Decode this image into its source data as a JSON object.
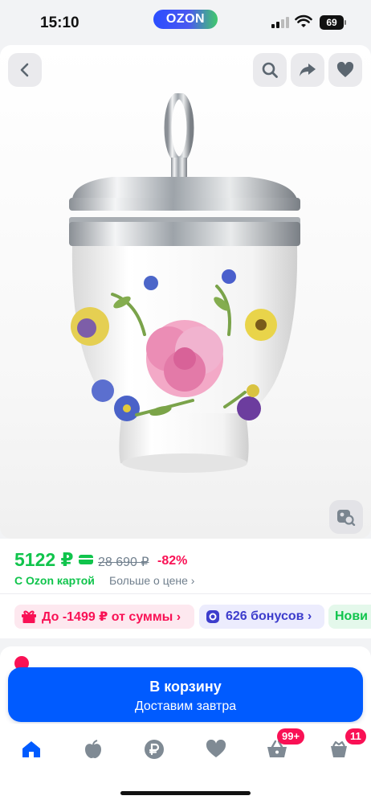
{
  "status_bar": {
    "time": "15:10",
    "app_badge": "OZON",
    "battery": "69"
  },
  "gallery": {
    "back_icon": "chevron-left-icon",
    "search_icon": "search-icon",
    "share_icon": "share-icon",
    "favorite_icon": "heart-icon",
    "photo_search_icon": "image-search-icon"
  },
  "price": {
    "current": "5122 ₽",
    "old": "28 690 ₽",
    "discount": "-82%",
    "card_label": "С Ozon картой",
    "more_link": "Больше о цене ›"
  },
  "promos": [
    {
      "icon": "gift-icon",
      "label": "До -1499 ₽ от суммы ›"
    },
    {
      "icon": "bonus-icon",
      "label": "626 бонусов ›"
    },
    {
      "icon": "",
      "label": "Нови"
    }
  ],
  "cart_button": {
    "title": "В корзину",
    "subtitle": "Доставим завтра"
  },
  "bottom_nav": {
    "items": [
      {
        "icon": "home-icon",
        "badge": ""
      },
      {
        "icon": "fresh-apple-icon",
        "badge": ""
      },
      {
        "icon": "ruble-icon",
        "badge": ""
      },
      {
        "icon": "heart-icon",
        "badge": ""
      },
      {
        "icon": "cart-icon",
        "badge": "99+"
      },
      {
        "icon": "profile-icon",
        "badge": "11"
      }
    ]
  },
  "colors": {
    "brand_blue": "#005bff",
    "price_green": "#10c44c",
    "accent_red": "#f91155"
  }
}
